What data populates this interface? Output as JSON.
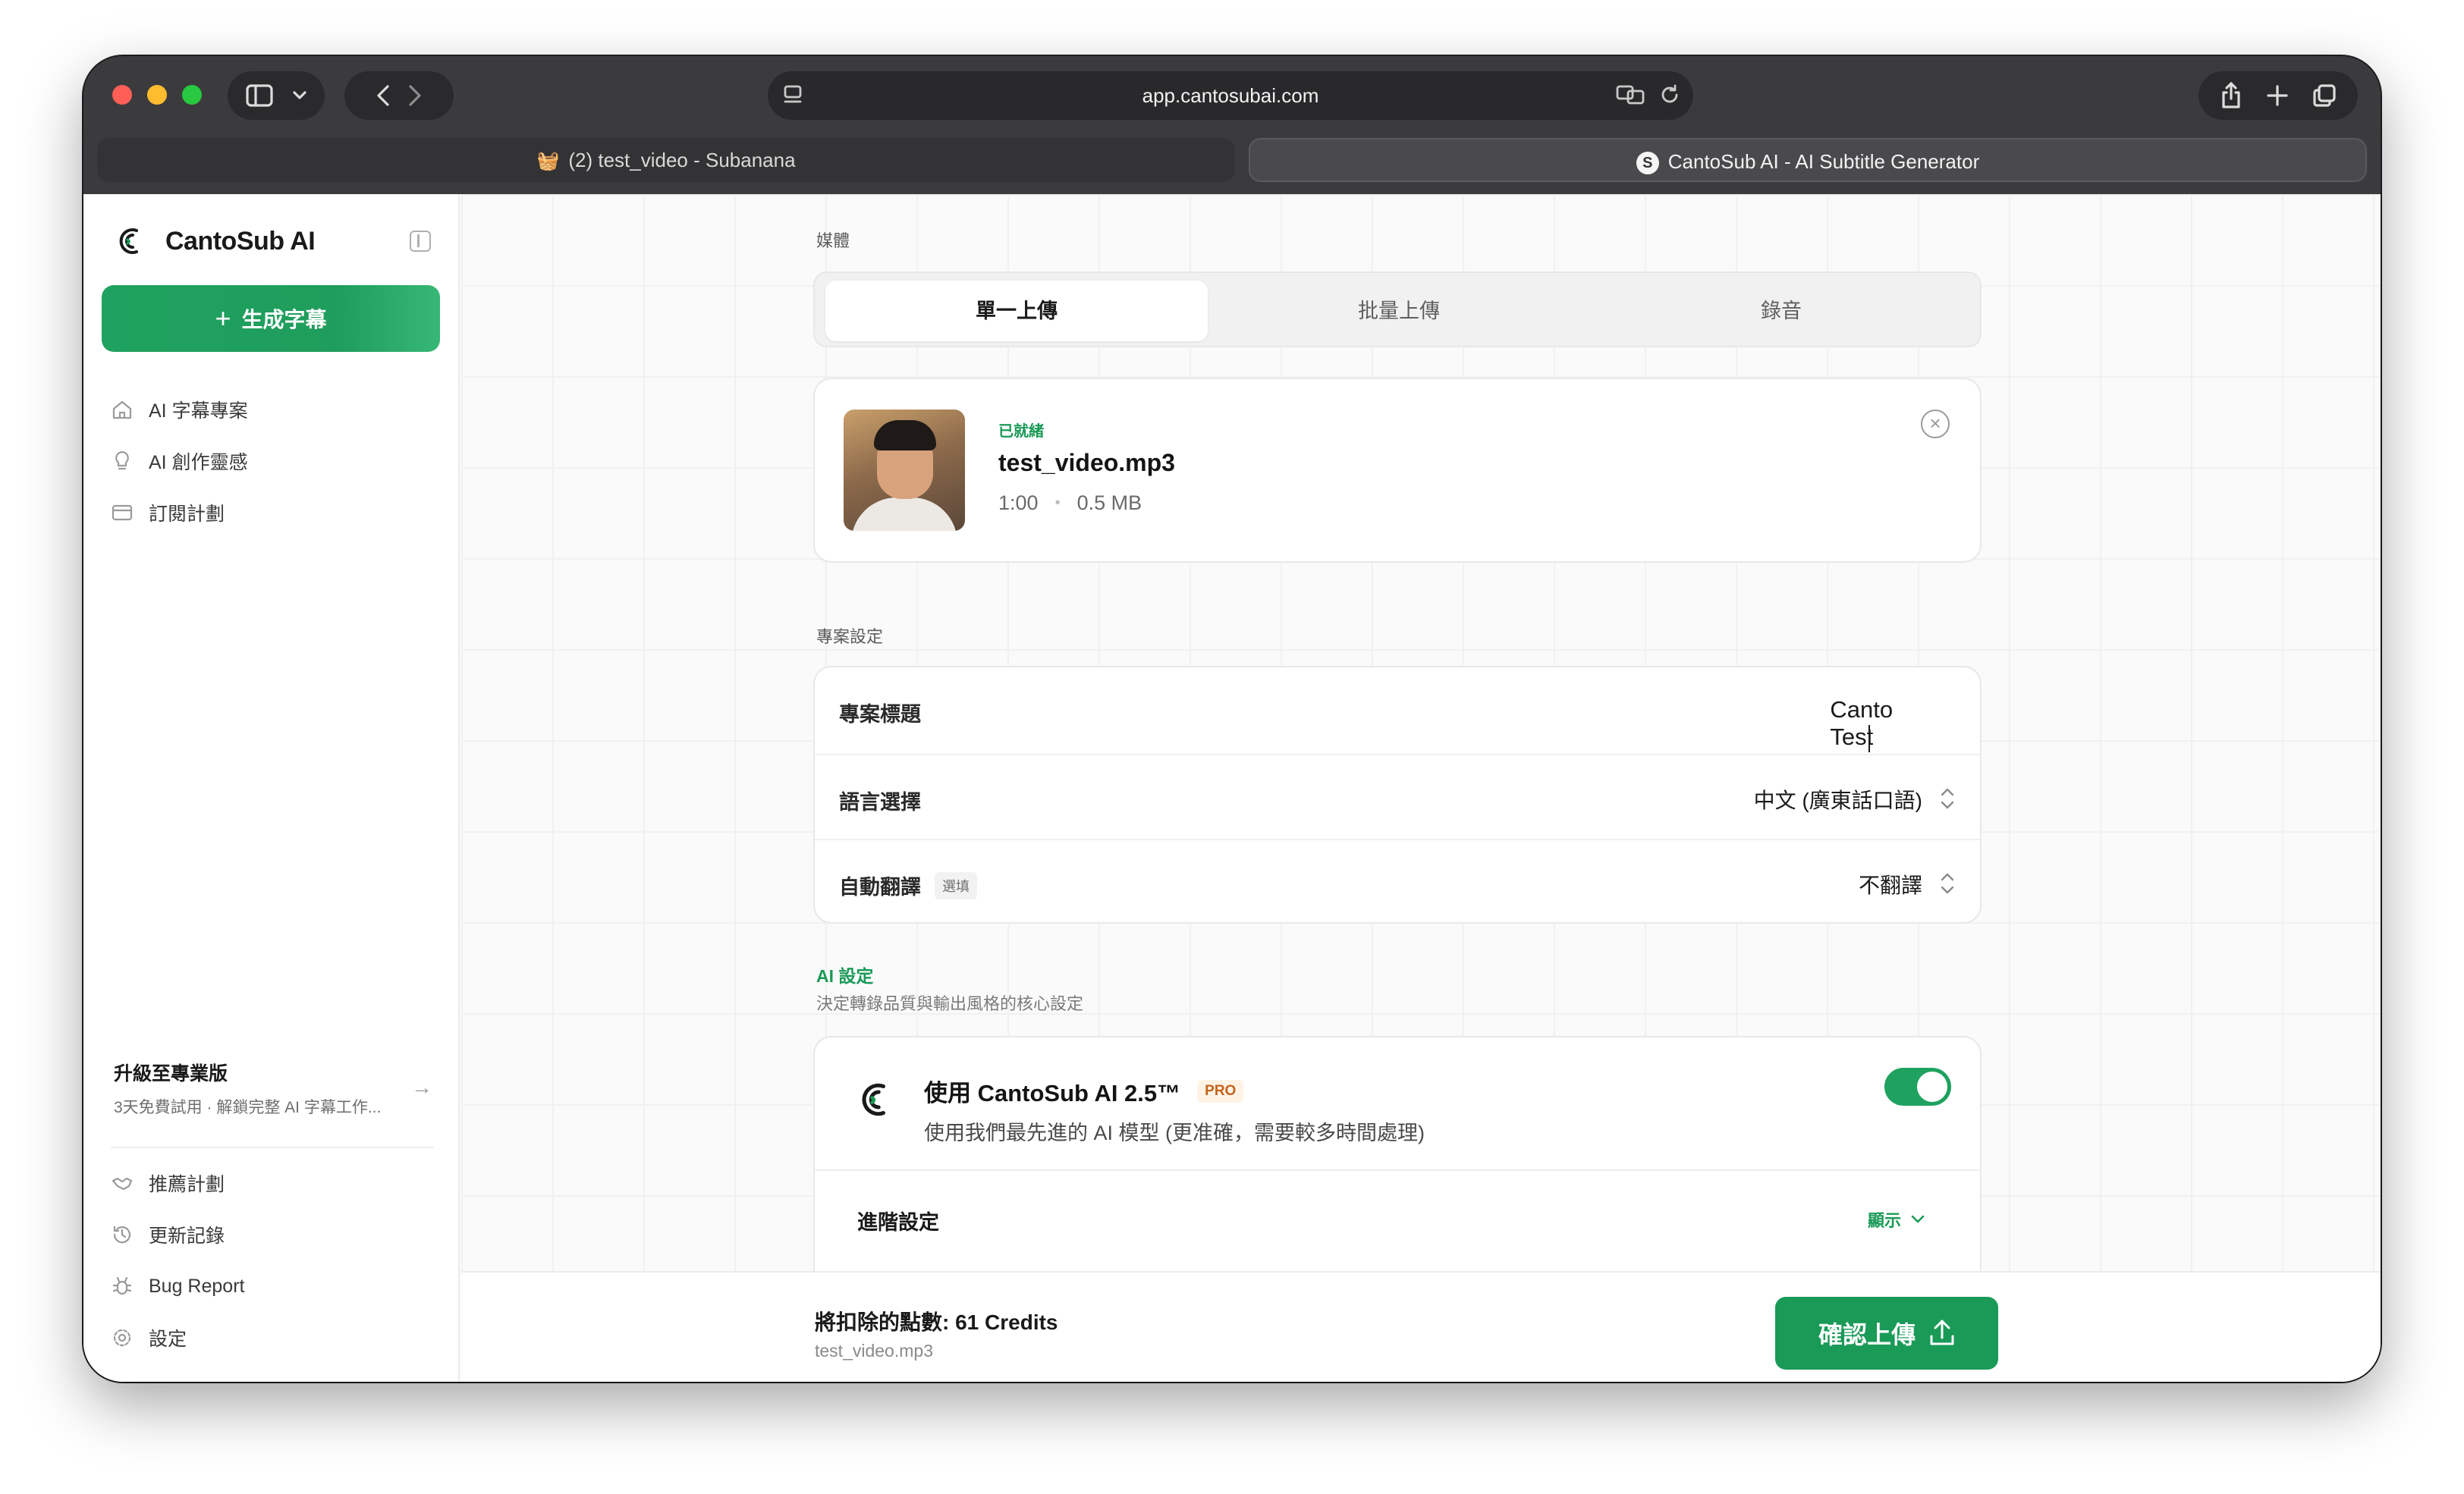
{
  "browser": {
    "url": "app.cantosubai.com",
    "tabs": [
      {
        "label": "(2) test_video - Subanana",
        "icon": "basket-emoji-icon",
        "active": false
      },
      {
        "label": "CantoSub AI - AI Subtitle Generator",
        "icon": "cantosub-favicon",
        "active": true
      }
    ]
  },
  "sidebar": {
    "brand": "CantoSub AI",
    "generate_label": "生成字幕",
    "nav": [
      {
        "label": "AI 字幕專案",
        "icon": "home-icon"
      },
      {
        "label": "AI 創作靈感",
        "icon": "lightbulb-icon"
      },
      {
        "label": "訂閱計劃",
        "icon": "card-icon"
      }
    ],
    "upgrade": {
      "title": "升級至專業版",
      "subtitle": "3天免費試用 · 解鎖完整 AI 字幕工作..."
    },
    "bottom_nav": [
      {
        "label": "推薦計劃",
        "icon": "handshake-icon"
      },
      {
        "label": "更新記錄",
        "icon": "history-icon"
      },
      {
        "label": "Bug Report",
        "icon": "bug-icon"
      },
      {
        "label": "設定",
        "icon": "gear-icon"
      }
    ]
  },
  "media": {
    "section_label": "媒體",
    "tabs": [
      "單一上傳",
      "批量上傳",
      "錄音"
    ],
    "active_tab": "單一上傳",
    "file": {
      "status": "已就緒",
      "name": "test_video.mp3",
      "duration": "1:00",
      "separator": "•",
      "size": "0.5 MB"
    }
  },
  "project": {
    "section_label": "專案設定",
    "rows": [
      {
        "label": "專案標題",
        "value": "Canto Test",
        "type": "text-input"
      },
      {
        "label": "語言選擇",
        "value": "中文 (廣東話口語)",
        "type": "select"
      },
      {
        "label": "自動翻譯",
        "badge": "選填",
        "value": "不翻譯",
        "type": "select"
      }
    ]
  },
  "ai": {
    "section_title": "AI 設定",
    "section_subtitle": "決定轉錄品質與輸出風格的核心設定",
    "model_name": "使用 CantoSub AI 2.5™",
    "badge": "PRO",
    "description": "使用我們最先進的 AI 模型 (更准確，需要較多時間處理)",
    "enabled": true,
    "advanced_label": "進階設定",
    "advanced_toggle": "顯示"
  },
  "footer": {
    "credits_text": "將扣除的點數: 61 Credits",
    "file_name": "test_video.mp3",
    "confirm_label": "確認上傳"
  },
  "colors": {
    "accent": "#1a9a57",
    "pro": "#c4621a"
  }
}
